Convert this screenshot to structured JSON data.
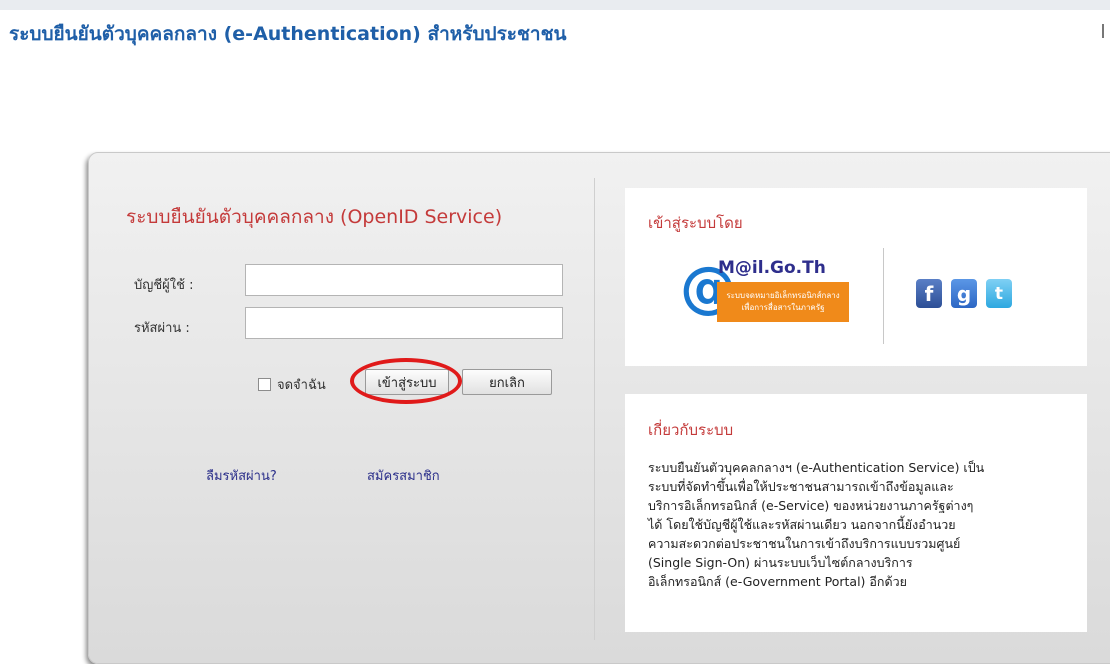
{
  "page": {
    "title": "ระบบยืนยันตัวบุคคลกลาง (e-Authentication) สำหรับประชาชน"
  },
  "login": {
    "heading": "ระบบยืนยันตัวบุคคลกลาง (OpenID Service)",
    "username_label": "บัญชีผู้ใช้ :",
    "username_value": "",
    "password_label": "รหัสผ่าน :",
    "password_value": "",
    "remember_label": "จดจำฉัน",
    "remember_checked": false,
    "login_button": "เข้าสู่ระบบ",
    "cancel_button": "ยกเลิก",
    "forgot_link": "ลืมรหัสผ่าน?",
    "register_link": "สมัครสมาชิก"
  },
  "sso": {
    "heading": "เข้าสู่ระบบโดย",
    "mail_logo": {
      "name": "M@il.Go.Th",
      "tagline_line1": "ระบบจดหมายอิเล็กทรอนิกส์กลาง",
      "tagline_line2": "เพื่อการสื่อสารในภาครัฐ"
    },
    "providers": [
      {
        "icon": "facebook-icon",
        "glyph": "f",
        "color": "#3b5998"
      },
      {
        "icon": "google-icon",
        "glyph": "g",
        "color": "#3b7be0"
      },
      {
        "icon": "twitter-icon",
        "glyph": "t",
        "color": "#35b3ea"
      }
    ]
  },
  "about": {
    "heading": "เกี่ยวกับระบบ",
    "lines": [
      "ระบบยืนยันตัวบุคคลกลางฯ (e-Authentication Service) เป็น",
      "ระบบที่จัดทำขึ้นเพื่อให้ประชาชนสามารถเข้าถึงข้อมูลและ",
      "บริการอิเล็กทรอนิกส์ (e-Service) ของหน่วยงานภาครัฐต่างๆ",
      "ได้ โดยใช้บัญชีผู้ใช้และรหัสผ่านเดียว นอกจากนี้ยังอำนวย",
      "ความสะดวกต่อประชาชนในการเข้าถึงบริการแบบรวมศูนย์",
      "(Single Sign-On) ผ่านระบบเว็บไซต์กลางบริการ",
      "อิเล็กทรอนิกส์ (e-Government Portal) อีกด้วย"
    ]
  },
  "colors": {
    "title_blue": "#1f5fa8",
    "heading_red": "#c43a3a",
    "highlight_ring": "#e01a1a",
    "link_blue": "#2b2f8a"
  }
}
